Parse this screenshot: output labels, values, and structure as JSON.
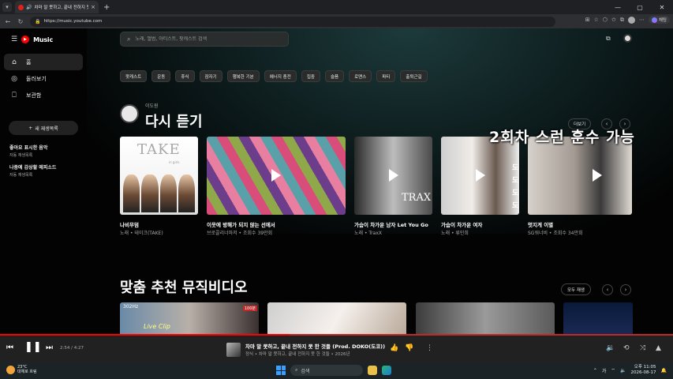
{
  "browser": {
    "tab_title": "차마 말 못하고, 끝내 전하지 못 한 것들",
    "url": "https://music.youtube.com",
    "copilot_label": "채팅"
  },
  "sidebar": {
    "logo": "Music",
    "items": [
      {
        "label": "홈",
        "icon": "home-icon"
      },
      {
        "label": "둘러보기",
        "icon": "explore-icon"
      },
      {
        "label": "보관함",
        "icon": "library-icon"
      }
    ],
    "new_playlist": "새 재생목록",
    "playlists": [
      {
        "title": "좋아요 표시한 음악",
        "sub": "자동 재생목록"
      },
      {
        "title": "나중에 감상할 에피소드",
        "sub": "자동 재생목록"
      }
    ]
  },
  "search": {
    "placeholder": "노래, 앨범, 아티스트, 팟캐스트 검색"
  },
  "chips": [
    "팟캐스트",
    "운동",
    "휴식",
    "잠자기",
    "행복한 기분",
    "에너지 충전",
    "집중",
    "슬픔",
    "로맨스",
    "파티",
    "출퇴근길"
  ],
  "section1": {
    "user": "이도원",
    "title": "다시 듣기",
    "more": "더보기",
    "overlay": "2회차 스런 훈수 가능",
    "cards": [
      {
        "title": "나비무덤",
        "sub": "노래 • 테이크(TAKE)",
        "art_text": "TAKE",
        "art_sub": "in girls"
      },
      {
        "title": "이웃에 방해가 되지 않는 선에서",
        "sub": "브로콜리너마저 • 조회수 39만회"
      },
      {
        "title": "가슴이 차가운 남자 Let You Go",
        "sub": "노래 • TraxX",
        "art_text": "TRAX"
      },
      {
        "title": "가슴이 차가운 여자",
        "sub": "노래 • 류민희",
        "art_text": "도바\n도바\n도바\n도바"
      },
      {
        "title": "멋지게 이별",
        "sub": "SG워너비 • 조회수 34만회"
      }
    ]
  },
  "section2": {
    "title": "맞춤 추천 뮤직비디오",
    "play_all": "모두 재생",
    "v1_tag": "302Hz",
    "v1_caption": "Live Clip",
    "v1_badge": "100분"
  },
  "player": {
    "time": "2:54 / 4:27",
    "title": "차마 말 못하고, 끝내 전하지 못 한 것들 (Prod. DOKO(도코))",
    "sub": "정식 • 차마 말 못하고, 끝내 전하지 못 한 것들 • 2026년",
    "progress": 0.43
  },
  "taskbar": {
    "temp": "23°C",
    "weather": "대체로 흐림",
    "search": "검색",
    "lang": "가",
    "time": "오후 11:05",
    "date": "2026-08-17"
  }
}
